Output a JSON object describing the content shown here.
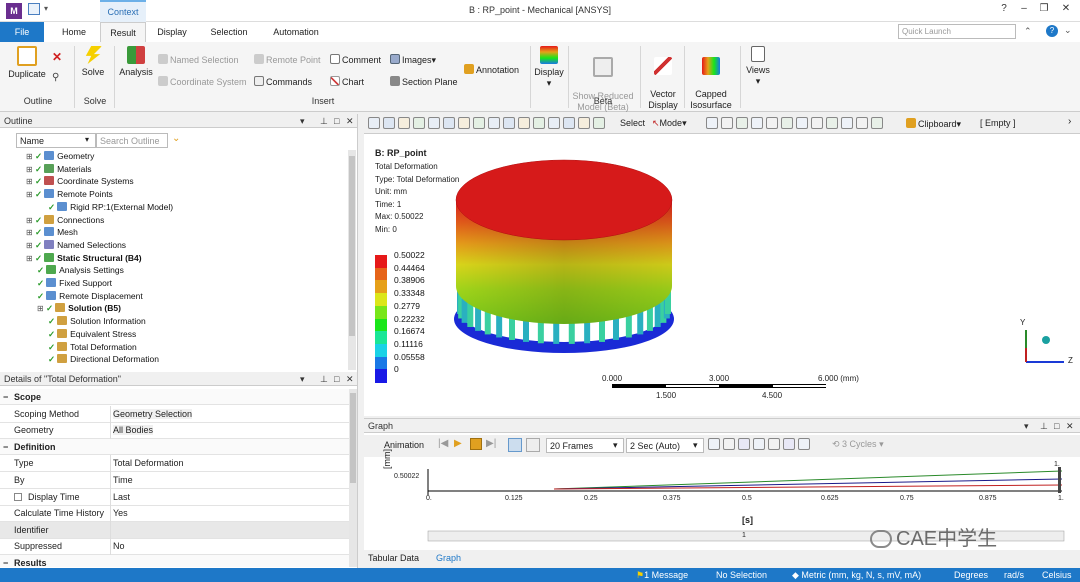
{
  "window": {
    "title": "B : RP_point - Mechanical [ANSYS]",
    "app_icon": "M",
    "context_tab": "Context"
  },
  "tabs": [
    "File",
    "Home",
    "Result",
    "Display",
    "Selection",
    "Automation"
  ],
  "quick_launch_placeholder": "Quick Launch",
  "ribbon": {
    "duplicate": "Duplicate",
    "solve": "Solve",
    "analysis": "Analysis",
    "named_selection": "Named Selection",
    "coordinate_system": "Coordinate System",
    "remote_point": "Remote Point",
    "commands": "Commands",
    "comment": "Comment",
    "chart": "Chart",
    "images": "Images",
    "section_plane": "Section Plane",
    "annotation": "Annotation",
    "display": "Display",
    "show_reduced_model": "Show Reduced\nModel (Beta)",
    "vector_display": "Vector\nDisplay",
    "capped_isosurface": "Capped\nIsosurface",
    "views": "Views",
    "groups": {
      "outline": "Outline",
      "solve": "Solve",
      "insert": "Insert",
      "beta": "Beta"
    }
  },
  "outline": {
    "title": "Outline",
    "name_label": "Name",
    "search_placeholder": "Search Outline",
    "items": [
      {
        "label": "Geometry",
        "indent": 0,
        "bold": false,
        "color": "#5b8fd0"
      },
      {
        "label": "Materials",
        "indent": 0,
        "bold": false,
        "color": "#58a058"
      },
      {
        "label": "Coordinate Systems",
        "indent": 0,
        "bold": false,
        "color": "#c05050"
      },
      {
        "label": "Remote Points",
        "indent": 0,
        "bold": false,
        "color": "#5b8fd0"
      },
      {
        "label": "Rigid RP:1(External Model)",
        "indent": 2,
        "bold": false,
        "color": "#5b8fd0"
      },
      {
        "label": "Connections",
        "indent": 0,
        "bold": false,
        "color": "#d0a040"
      },
      {
        "label": "Mesh",
        "indent": 0,
        "bold": false,
        "color": "#5b8fd0"
      },
      {
        "label": "Named Selections",
        "indent": 0,
        "bold": false,
        "color": "#8080c0"
      },
      {
        "label": "Static Structural (B4)",
        "indent": 0,
        "bold": true,
        "color": "#4ea84e"
      },
      {
        "label": "Analysis Settings",
        "indent": 1,
        "bold": false,
        "color": "#4ea84e"
      },
      {
        "label": "Fixed Support",
        "indent": 1,
        "bold": false,
        "color": "#5b8fd0"
      },
      {
        "label": "Remote Displacement",
        "indent": 1,
        "bold": false,
        "color": "#5b8fd0"
      },
      {
        "label": "Solution (B5)",
        "indent": 1,
        "bold": true,
        "color": "#d0a040"
      },
      {
        "label": "Solution Information",
        "indent": 2,
        "bold": false,
        "color": "#d0a040"
      },
      {
        "label": "Equivalent Stress",
        "indent": 2,
        "bold": false,
        "color": "#d0a040"
      },
      {
        "label": "Total Deformation",
        "indent": 2,
        "bold": false,
        "color": "#d0a040"
      },
      {
        "label": "Directional Deformation",
        "indent": 2,
        "bold": false,
        "color": "#d0a040"
      }
    ]
  },
  "details": {
    "title": "Details of \"Total Deformation\"",
    "sections": [
      {
        "name": "Scope",
        "rows": [
          [
            "Scoping Method",
            "Geometry Selection"
          ],
          [
            "Geometry",
            "All Bodies"
          ]
        ]
      },
      {
        "name": "Definition",
        "rows": [
          [
            "Type",
            "Total Deformation"
          ],
          [
            "By",
            "Time"
          ],
          [
            "Display Time",
            "Last"
          ],
          [
            "Calculate Time History",
            "Yes"
          ],
          [
            "Identifier",
            ""
          ],
          [
            "Suppressed",
            "No"
          ]
        ]
      },
      {
        "name": "Results",
        "rows": []
      }
    ]
  },
  "graphics_toolbar": {
    "select": "Select",
    "mode": "Mode",
    "clipboard": "Clipboard",
    "empty": "[ Empty ]"
  },
  "result_info": {
    "title": "B: RP_point",
    "lines": [
      "Total Deformation",
      "Type: Total Deformation",
      "Unit: mm",
      "Time: 1",
      "Max: 0.50022",
      "Min: 0"
    ]
  },
  "legend": {
    "labels": [
      "0.50022",
      "0.44464",
      "0.38906",
      "0.33348",
      "0.2779",
      "0.22232",
      "0.16674",
      "0.11116",
      "0.05558",
      "0"
    ],
    "colors": [
      "#e61919",
      "#e66419",
      "#e6a019",
      "#dce619",
      "#78e619",
      "#19e619",
      "#19e696",
      "#19d2e6",
      "#1978e6",
      "#1919e6"
    ]
  },
  "scale_bar": {
    "top": [
      "0.000",
      "3.000",
      "6.000 (mm)"
    ],
    "bottom": [
      "1.500",
      "4.500"
    ]
  },
  "graph": {
    "title": "Graph",
    "animation": "Animation",
    "frames": "20 Frames",
    "duration": "2 Sec (Auto)",
    "cycles": "3 Cycles",
    "ylabel": "[mm]",
    "xlabel": "[s]",
    "y_tick": "0.50022",
    "x_ticks": [
      "0.",
      "0.125",
      "0.25",
      "0.375",
      "0.5",
      "0.625",
      "0.75",
      "0.875",
      "1."
    ],
    "timeline_label": "1",
    "end_label": "1.",
    "series_colors": [
      "#2a8a2a",
      "#1a1a8a",
      "#c02020"
    ]
  },
  "bottom_tabs": [
    "Tabular Data",
    "Graph"
  ],
  "watermark": "CAE中学生",
  "status": {
    "message": "1 Message",
    "selection": "No Selection",
    "units": "Metric (mm, kg, N, s, mV, mA)",
    "degrees": "Degrees",
    "rads": "rad/s",
    "temp": "Celsius"
  },
  "axes": {
    "y": "Y",
    "z": "Z"
  }
}
